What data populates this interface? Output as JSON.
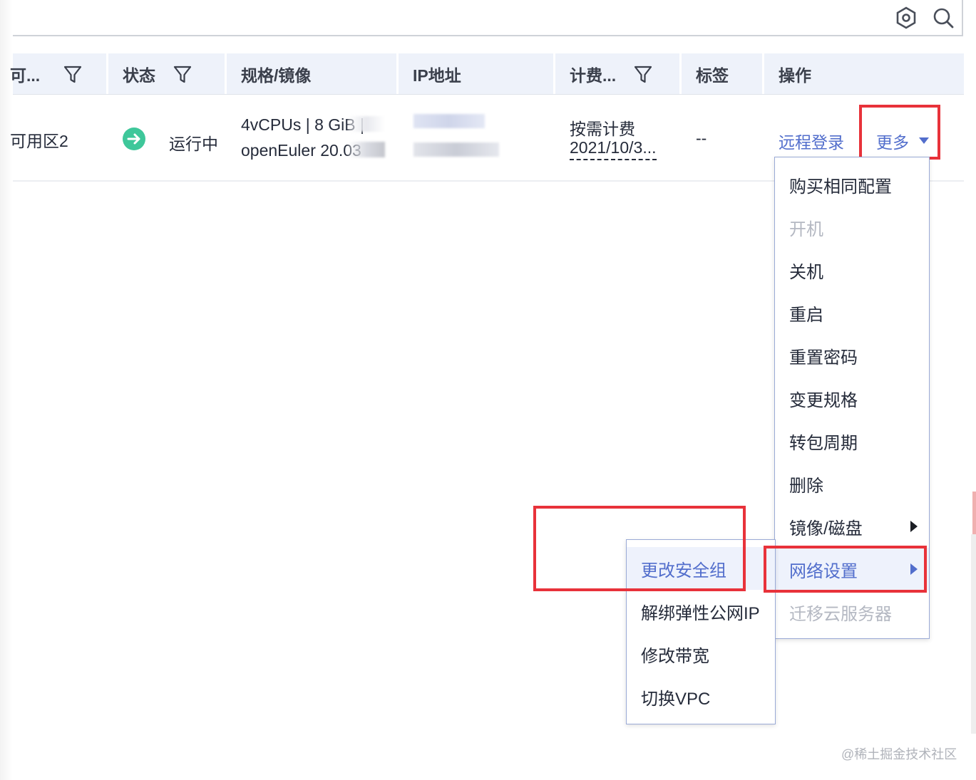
{
  "toolbar": {
    "icons": [
      "settings-icon",
      "search-icon"
    ]
  },
  "table": {
    "headers": [
      "可...",
      "状态",
      "规格/镜像",
      "IP地址",
      "计费...",
      "标签",
      "操作"
    ],
    "row": {
      "zone": "可用区2",
      "status": "运行中",
      "spec_line1": "4vCPUs | 8 GiB |",
      "spec_line2": "openEuler 20.03",
      "billing_line1": "按需计费",
      "billing_line2": "2021/10/3...",
      "tags": "--",
      "action_remote": "远程登录",
      "action_more": "更多"
    }
  },
  "more_menu": [
    {
      "label": "购买相同配置",
      "disabled": false
    },
    {
      "label": "开机",
      "disabled": true
    },
    {
      "label": "关机",
      "disabled": false
    },
    {
      "label": "重启",
      "disabled": false
    },
    {
      "label": "重置密码",
      "disabled": false
    },
    {
      "label": "变更规格",
      "disabled": false
    },
    {
      "label": "转包周期",
      "disabled": false
    },
    {
      "label": "删除",
      "disabled": false
    },
    {
      "label": "镜像/磁盘",
      "disabled": false,
      "submenu": true
    },
    {
      "label": "网络设置",
      "disabled": false,
      "submenu": true,
      "active": true
    },
    {
      "label": "迁移云服务器",
      "disabled": true
    }
  ],
  "network_submenu": [
    {
      "label": "更改安全组",
      "active": true
    },
    {
      "label": "解绑弹性公网IP"
    },
    {
      "label": "修改带宽"
    },
    {
      "label": "切换VPC"
    }
  ],
  "watermark": "@稀土掘金技术社区",
  "colors": {
    "accent": "#526ecc",
    "highlight": "#e8323a",
    "status_ok": "#3ec79a"
  }
}
